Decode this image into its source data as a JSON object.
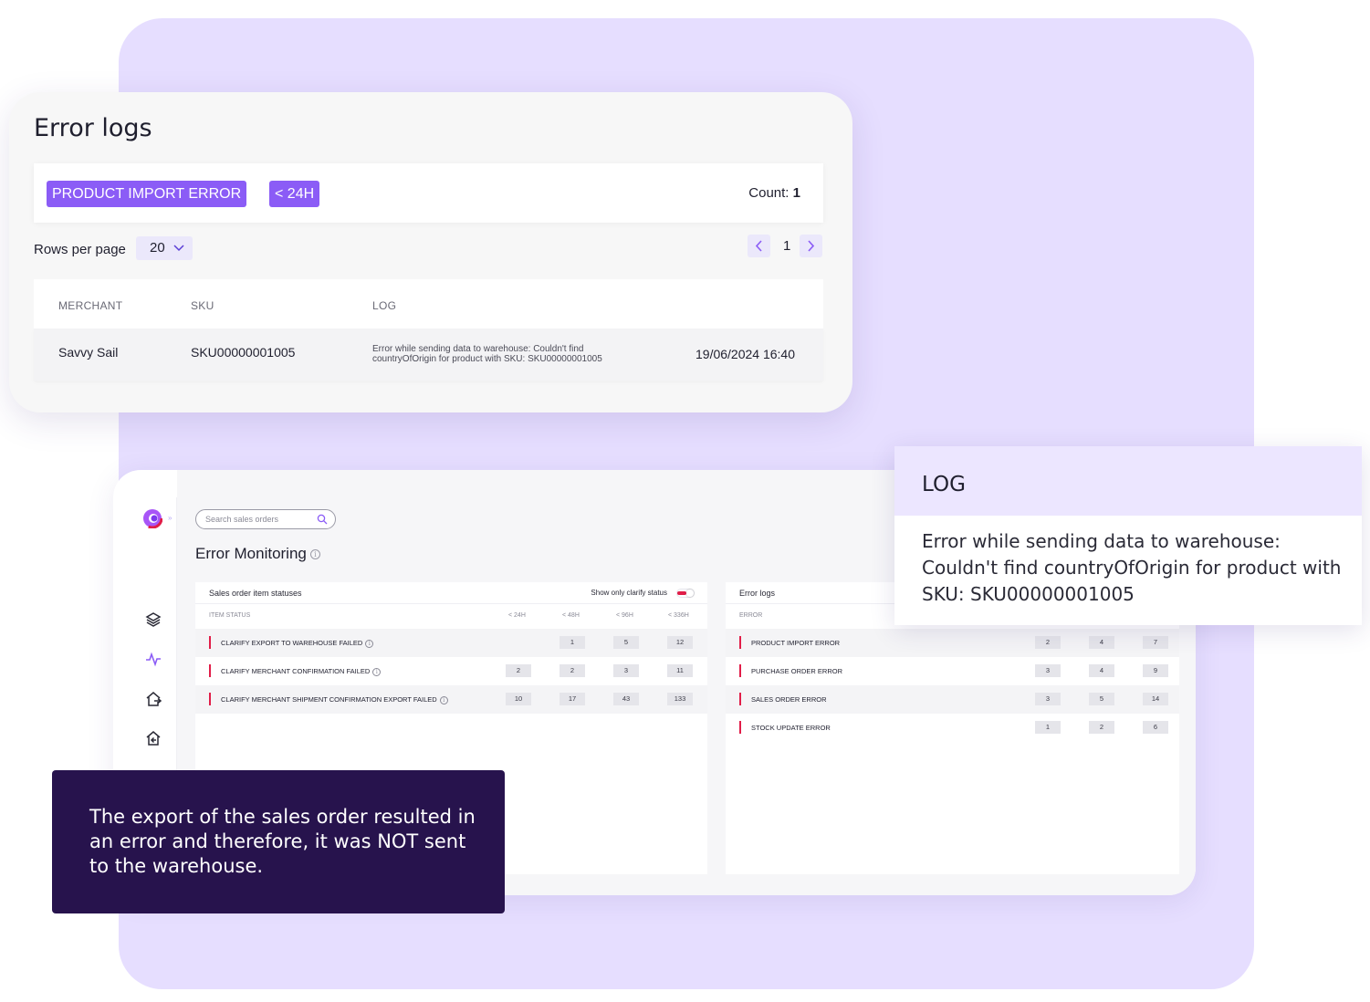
{
  "error_logs_card": {
    "title": "Error logs",
    "filters": [
      "PRODUCT IMPORT ERROR",
      "< 24H"
    ],
    "count_label": "Count:",
    "count_value": "1",
    "rows_per_page_label": "Rows per page",
    "rows_per_page_value": "20",
    "page": "1",
    "columns": [
      "MERCHANT",
      "SKU",
      "LOG"
    ],
    "row": {
      "merchant": "Savvy Sail",
      "sku": "SKU00000001005",
      "log": "Error while sending data to warehouse: Couldn't find countryOfOrigin for product with SKU: SKU00000001005",
      "date": "19/06/2024 16:40"
    }
  },
  "dashboard": {
    "search_placeholder": "Search sales orders",
    "page_title": "Error Monitoring",
    "info_glyph": "i",
    "sidebar_icons": [
      "layers-icon",
      "activity-icon",
      "export-icon",
      "import-icon"
    ],
    "sales_card": {
      "title": "Sales order item statuses",
      "toggle_label": "Show only clarify status",
      "columns": [
        "ITEM STATUS",
        "< 24H",
        "< 48H",
        "< 96H",
        "< 336H"
      ],
      "rows": [
        {
          "label": "CLARIFY EXPORT TO WAREHOUSE FAILED",
          "values": [
            "",
            "1",
            "5",
            "12"
          ]
        },
        {
          "label": "CLARIFY MERCHANT CONFIRMATION FAILED",
          "values": [
            "2",
            "2",
            "3",
            "11"
          ]
        },
        {
          "label": "CLARIFY MERCHANT SHIPMENT CONFIRMATION EXPORT FAILED",
          "values": [
            "10",
            "17",
            "43",
            "133"
          ]
        }
      ]
    },
    "errors_card": {
      "title": "Error logs",
      "columns": [
        "ERROR"
      ],
      "rows": [
        {
          "label": "PRODUCT IMPORT ERROR",
          "values": [
            "2",
            "4",
            "7"
          ]
        },
        {
          "label": "PURCHASE ORDER ERROR",
          "values": [
            "3",
            "4",
            "9"
          ]
        },
        {
          "label": "SALES ORDER ERROR",
          "values": [
            "3",
            "5",
            "14"
          ]
        },
        {
          "label": "STOCK UPDATE ERROR",
          "values": [
            "1",
            "2",
            "6"
          ]
        }
      ]
    }
  },
  "log_popover": {
    "title": "LOG",
    "body": "Error while sending data to warehouse: Couldn't find countryOfOrigin for product with SKU: SKU00000001005"
  },
  "callout": {
    "text": "The export of the sales order resulted in an error and therefore, it was NOT sent to the warehouse."
  },
  "colors": {
    "accent": "#8b5cf6",
    "background_panel": "#e6deff",
    "callout_bg": "#27134d",
    "error_marker": "#e11d48"
  }
}
